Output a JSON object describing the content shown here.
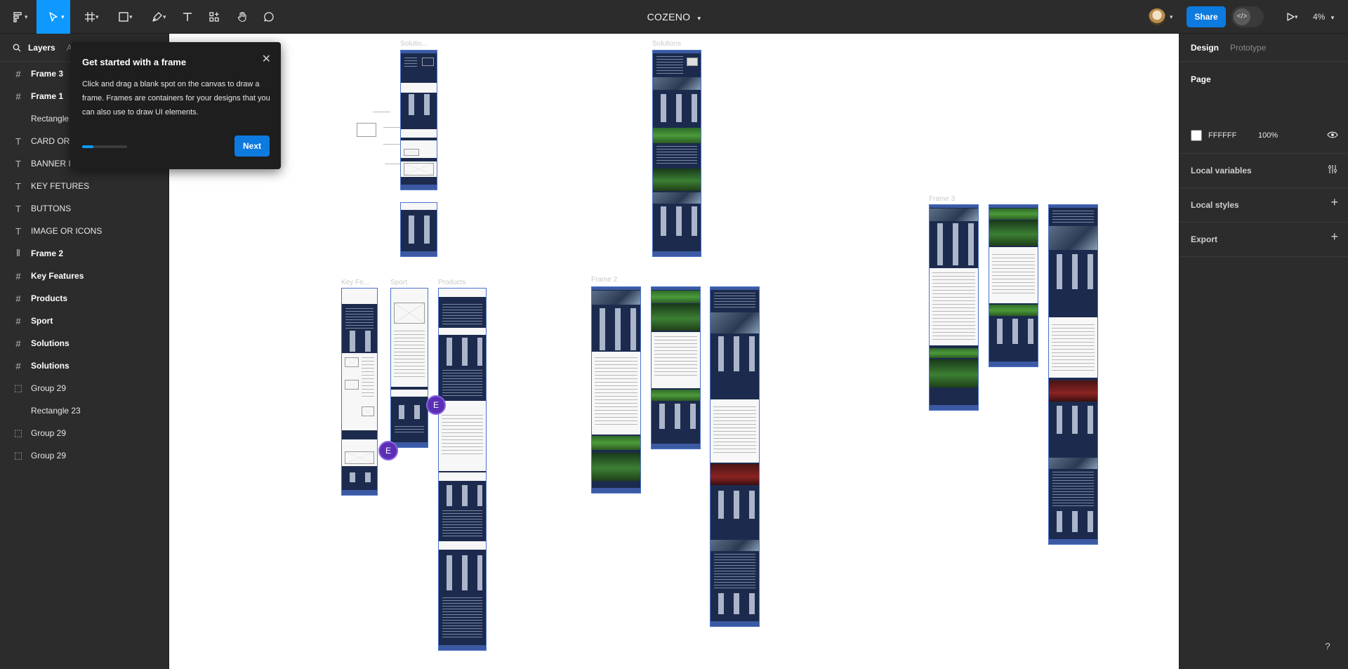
{
  "toolbar": {
    "file_name": "COZENO",
    "share_label": "Share",
    "zoom": "4%",
    "dev_mode_icon": "</>"
  },
  "left_panel": {
    "tabs": [
      "Layers",
      "As"
    ],
    "layers": [
      {
        "icon": "frame-icon",
        "name": "Frame 3",
        "bold": true
      },
      {
        "icon": "frame-icon",
        "name": "Frame 1",
        "bold": true
      },
      {
        "icon": "rectangle-icon",
        "name": "Rectangle 2",
        "bold": false
      },
      {
        "icon": "text-icon",
        "name": "CARD OR P",
        "bold": false
      },
      {
        "icon": "text-icon",
        "name": "BANNER IM",
        "bold": false
      },
      {
        "icon": "text-icon",
        "name": "KEY FETURES",
        "bold": false
      },
      {
        "icon": "text-icon",
        "name": "BUTTONS",
        "bold": false
      },
      {
        "icon": "text-icon",
        "name": "IMAGE OR ICONS",
        "bold": false
      },
      {
        "icon": "auto-layout-icon",
        "name": "Frame 2",
        "bold": true
      },
      {
        "icon": "frame-icon",
        "name": "Key Features",
        "bold": true
      },
      {
        "icon": "frame-icon",
        "name": "Products",
        "bold": true
      },
      {
        "icon": "frame-icon",
        "name": "Sport",
        "bold": true
      },
      {
        "icon": "frame-icon",
        "name": "Solutions",
        "bold": true
      },
      {
        "icon": "frame-icon",
        "name": "Solutions",
        "bold": true
      },
      {
        "icon": "group-icon",
        "name": "Group 29",
        "bold": false
      },
      {
        "icon": "rectangle-icon",
        "name": "Rectangle 23",
        "bold": false
      },
      {
        "icon": "group-icon",
        "name": "Group 29",
        "bold": false
      },
      {
        "icon": "group-icon",
        "name": "Group 29",
        "bold": false
      }
    ]
  },
  "popup": {
    "title": "Get started with a frame",
    "body": "Click and drag a blank spot on the canvas to draw a frame. Frames are containers for your designs that you can also use to draw UI elements.",
    "next_label": "Next",
    "progress": 0.25
  },
  "canvas": {
    "frame_labels": {
      "solutions_1": "Solutio...",
      "solutions_2": "Solutions",
      "key_features": "Key Fe...",
      "sport": "Sport",
      "products": "Products",
      "frame_2": "Frame 2",
      "frame_3": "Frame 3"
    },
    "cursor_initial": "E"
  },
  "right_panel": {
    "tabs": [
      "Design",
      "Prototype"
    ],
    "page_label": "Page",
    "page_color": "FFFFFF",
    "page_opacity": "100%",
    "sections": [
      "Local variables",
      "Local styles",
      "Export"
    ]
  },
  "colors": {
    "accent": "#0d99ff",
    "share": "#0d7ae0",
    "frame_navy": "#1c2b4d",
    "cursor_purple": "#5b2fb5"
  }
}
